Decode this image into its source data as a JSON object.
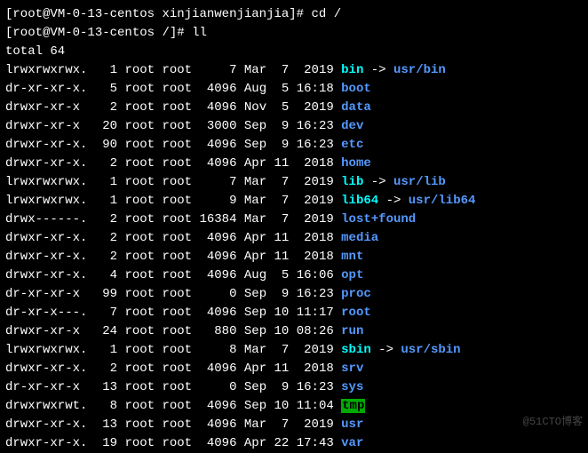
{
  "prompt1": {
    "user": "root",
    "host": "VM-0-13-centos",
    "path": "xinjianwenjianjia",
    "cmd": "cd /"
  },
  "prompt2": {
    "user": "root",
    "host": "VM-0-13-centos",
    "path": "/",
    "cmd": "ll"
  },
  "total": "total 64",
  "entries": [
    {
      "perms": "lrwxrwxrwx.",
      "links": "1",
      "owner": "root",
      "group": "root",
      "size": "7",
      "month": "Mar",
      "day": "7",
      "time": "2019",
      "name": "bin",
      "type": "symlink",
      "target": "usr/bin"
    },
    {
      "perms": "dr-xr-xr-x.",
      "links": "5",
      "owner": "root",
      "group": "root",
      "size": "4096",
      "month": "Aug",
      "day": "5",
      "time": "16:18",
      "name": "boot",
      "type": "dir"
    },
    {
      "perms": "drwxr-xr-x",
      "links": "2",
      "owner": "root",
      "group": "root",
      "size": "4096",
      "month": "Nov",
      "day": "5",
      "time": "2019",
      "name": "data",
      "type": "dir"
    },
    {
      "perms": "drwxr-xr-x",
      "links": "20",
      "owner": "root",
      "group": "root",
      "size": "3000",
      "month": "Sep",
      "day": "9",
      "time": "16:23",
      "name": "dev",
      "type": "dir"
    },
    {
      "perms": "drwxr-xr-x.",
      "links": "90",
      "owner": "root",
      "group": "root",
      "size": "4096",
      "month": "Sep",
      "day": "9",
      "time": "16:23",
      "name": "etc",
      "type": "dir"
    },
    {
      "perms": "drwxr-xr-x.",
      "links": "2",
      "owner": "root",
      "group": "root",
      "size": "4096",
      "month": "Apr",
      "day": "11",
      "time": "2018",
      "name": "home",
      "type": "dir"
    },
    {
      "perms": "lrwxrwxrwx.",
      "links": "1",
      "owner": "root",
      "group": "root",
      "size": "7",
      "month": "Mar",
      "day": "7",
      "time": "2019",
      "name": "lib",
      "type": "symlink",
      "target": "usr/lib"
    },
    {
      "perms": "lrwxrwxrwx.",
      "links": "1",
      "owner": "root",
      "group": "root",
      "size": "9",
      "month": "Mar",
      "day": "7",
      "time": "2019",
      "name": "lib64",
      "type": "symlink",
      "target": "usr/lib64"
    },
    {
      "perms": "drwx------.",
      "links": "2",
      "owner": "root",
      "group": "root",
      "size": "16384",
      "month": "Mar",
      "day": "7",
      "time": "2019",
      "name": "lost+found",
      "type": "dir"
    },
    {
      "perms": "drwxr-xr-x.",
      "links": "2",
      "owner": "root",
      "group": "root",
      "size": "4096",
      "month": "Apr",
      "day": "11",
      "time": "2018",
      "name": "media",
      "type": "dir"
    },
    {
      "perms": "drwxr-xr-x.",
      "links": "2",
      "owner": "root",
      "group": "root",
      "size": "4096",
      "month": "Apr",
      "day": "11",
      "time": "2018",
      "name": "mnt",
      "type": "dir"
    },
    {
      "perms": "drwxr-xr-x.",
      "links": "4",
      "owner": "root",
      "group": "root",
      "size": "4096",
      "month": "Aug",
      "day": "5",
      "time": "16:06",
      "name": "opt",
      "type": "dir"
    },
    {
      "perms": "dr-xr-xr-x",
      "links": "99",
      "owner": "root",
      "group": "root",
      "size": "0",
      "month": "Sep",
      "day": "9",
      "time": "16:23",
      "name": "proc",
      "type": "dir"
    },
    {
      "perms": "dr-xr-x---.",
      "links": "7",
      "owner": "root",
      "group": "root",
      "size": "4096",
      "month": "Sep",
      "day": "10",
      "time": "11:17",
      "name": "root",
      "type": "dir"
    },
    {
      "perms": "drwxr-xr-x",
      "links": "24",
      "owner": "root",
      "group": "root",
      "size": "880",
      "month": "Sep",
      "day": "10",
      "time": "08:26",
      "name": "run",
      "type": "dir"
    },
    {
      "perms": "lrwxrwxrwx.",
      "links": "1",
      "owner": "root",
      "group": "root",
      "size": "8",
      "month": "Mar",
      "day": "7",
      "time": "2019",
      "name": "sbin",
      "type": "symlink",
      "target": "usr/sbin"
    },
    {
      "perms": "drwxr-xr-x.",
      "links": "2",
      "owner": "root",
      "group": "root",
      "size": "4096",
      "month": "Apr",
      "day": "11",
      "time": "2018",
      "name": "srv",
      "type": "dir"
    },
    {
      "perms": "dr-xr-xr-x",
      "links": "13",
      "owner": "root",
      "group": "root",
      "size": "0",
      "month": "Sep",
      "day": "9",
      "time": "16:23",
      "name": "sys",
      "type": "dir"
    },
    {
      "perms": "drwxrwxrwt.",
      "links": "8",
      "owner": "root",
      "group": "root",
      "size": "4096",
      "month": "Sep",
      "day": "10",
      "time": "11:04",
      "name": "tmp",
      "type": "sticky"
    },
    {
      "perms": "drwxr-xr-x.",
      "links": "13",
      "owner": "root",
      "group": "root",
      "size": "4096",
      "month": "Mar",
      "day": "7",
      "time": "2019",
      "name": "usr",
      "type": "dir"
    },
    {
      "perms": "drwxr-xr-x.",
      "links": "19",
      "owner": "root",
      "group": "root",
      "size": "4096",
      "month": "Apr",
      "day": "22",
      "time": "17:43",
      "name": "var",
      "type": "dir"
    }
  ],
  "watermark": "@51CTO博客"
}
